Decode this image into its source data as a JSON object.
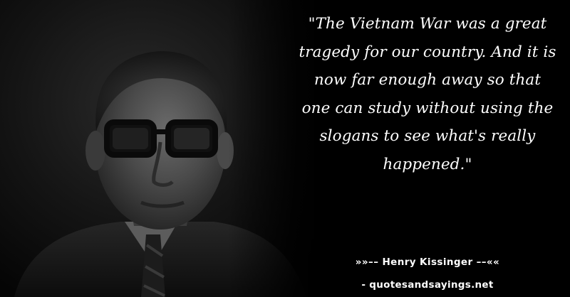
{
  "quote": {
    "text": "\"The Vietnam War was a great tragedy for our country. And it is now far enough away so that one can study without using the slogans to see what's really happened.\""
  },
  "attribution": {
    "text": "»»–– Henry Kissinger ––««"
  },
  "website": {
    "text": "- quotesandsayings.net"
  },
  "colors": {
    "background": "#000000",
    "text": "#ffffff"
  }
}
